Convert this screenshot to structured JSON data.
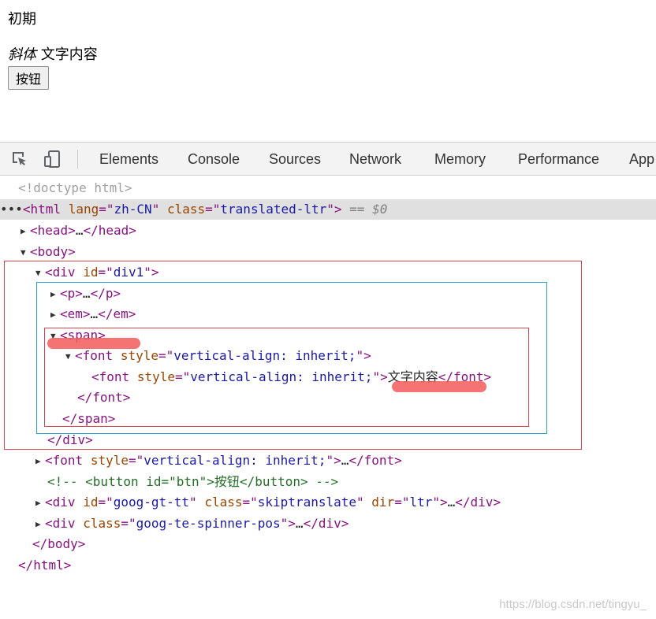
{
  "preview": {
    "p_text": "初期",
    "em_text": "斜体",
    "span_text": " 文字内容",
    "button_label": "按钮"
  },
  "toolbar": {
    "icons": [
      "inspect-icon",
      "device-toolbar-icon"
    ],
    "tabs": [
      {
        "label": "Elements",
        "active": true
      },
      {
        "label": "Console",
        "active": false
      },
      {
        "label": "Sources",
        "active": false
      },
      {
        "label": "Network",
        "active": false
      },
      {
        "label": "Memory",
        "active": false
      },
      {
        "label": "Performance",
        "active": false
      },
      {
        "label": "App",
        "active": false
      }
    ],
    "accent_color": "#1a73e8"
  },
  "tree": {
    "doctype": "<!doctype html>",
    "html_open": {
      "tag": "html",
      "attrs": [
        [
          "lang",
          "zh-CN"
        ],
        [
          "class",
          "translated-ltr"
        ]
      ],
      "suffix": " == $0"
    },
    "head": {
      "tag": "head"
    },
    "body": {
      "tag": "body"
    },
    "div1": {
      "tag": "div",
      "attrs": [
        [
          "id",
          "div1"
        ]
      ]
    },
    "p": {
      "tag": "p"
    },
    "em": {
      "tag": "em"
    },
    "span": {
      "tag": "span"
    },
    "font_outer": {
      "tag": "font",
      "attrs": [
        [
          "style",
          "vertical-align: inherit;"
        ]
      ]
    },
    "font_inner": {
      "tag": "font",
      "attrs": [
        [
          "style",
          "vertical-align: inherit;"
        ]
      ],
      "text": "文字内容"
    },
    "font_sibling": {
      "tag": "font",
      "attrs": [
        [
          "style",
          "vertical-align: inherit;"
        ]
      ]
    },
    "comment": "<!-- <button id=\"btn\">按钮</button> -->",
    "goog_tt": {
      "tag": "div",
      "attrs": [
        [
          "id",
          "goog-gt-tt"
        ],
        [
          "class",
          "skiptranslate"
        ],
        [
          "dir",
          "ltr"
        ]
      ]
    },
    "goog_spinner": {
      "tag": "div",
      "attrs": [
        [
          "class",
          "goog-te-spinner-pos"
        ]
      ]
    },
    "collapsed": "…"
  },
  "annotation_colors": {
    "red": "#d6434f",
    "teal": "#29a8c3",
    "highlight": "#f55a5a"
  },
  "watermark": "https://blog.csdn.net/tingyu_"
}
